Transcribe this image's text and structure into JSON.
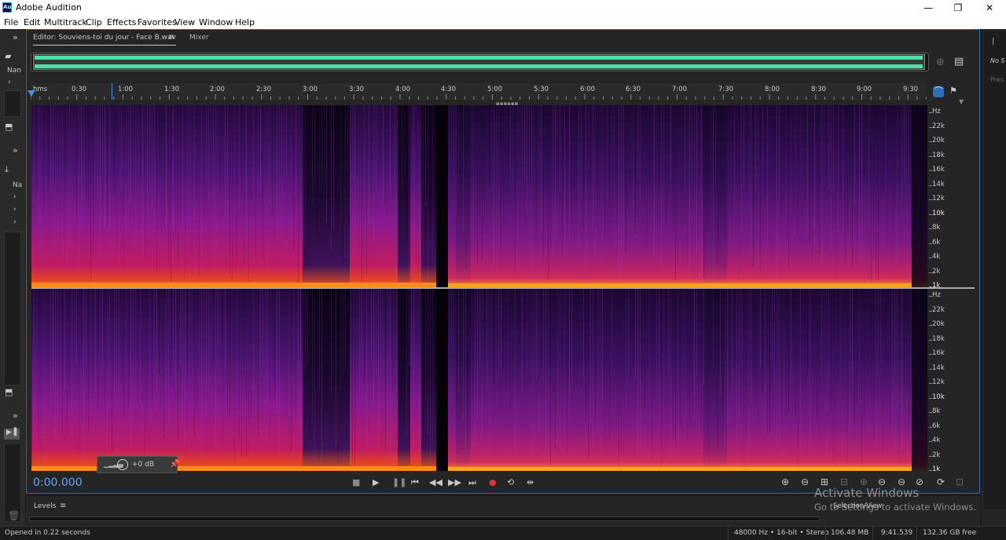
{
  "window": {
    "title": "Adobe Audition",
    "logo": "Au",
    "minimize": "—",
    "maximize": "❐",
    "close": "✕"
  },
  "menu": [
    "File",
    "Edit",
    "Multitrack",
    "Clip",
    "Effects",
    "Favorites",
    "View",
    "Window",
    "Help"
  ],
  "left_panels": {
    "files_label": "Nan",
    "effects_label": "Na"
  },
  "editor": {
    "tab_label": "Editor: Souviens-toi du jour - Face B.wav",
    "mixer_label": "Mixer",
    "ruler_labels": [
      "hms",
      "0:30",
      "1:00",
      "1:30",
      "2:00",
      "2:30",
      "3:00",
      "3:30",
      "4:00",
      "4:30",
      "5:00",
      "5:30",
      "6:00",
      "6:30",
      "7:00",
      "7:30",
      "8:00",
      "8:30",
      "9:00",
      "9:30"
    ],
    "hz_labels_top": [
      "Hz",
      "22k",
      "20k",
      "18k",
      "16k",
      "14k",
      "12k",
      "10k",
      "8k",
      "6k",
      "4k",
      "2k",
      "1k"
    ],
    "hz_labels_bottom": [
      "Hz",
      "22k",
      "20k",
      "18k",
      "16k",
      "14k",
      "12k",
      "10k",
      "8k",
      "6k",
      "4k",
      "2k",
      "1k"
    ],
    "hud_gain": "+0 dB",
    "time": "0:00.000",
    "waveform_color": "#4fe0a8"
  },
  "levels": {
    "label": "Levels",
    "selection_view": "Selection/View"
  },
  "right_panel": {
    "label1": "No S",
    "label2": "Pres"
  },
  "activate": {
    "title": "Activate Windows",
    "subtitle": "Go to Settings to activate Windows."
  },
  "status": {
    "opened": "Opened in 0.22 seconds",
    "format": "48000 Hz • 16-bit • Stereo",
    "size": "106.48 MB",
    "duration": "9:41.539",
    "free": "132.36 GB free"
  }
}
